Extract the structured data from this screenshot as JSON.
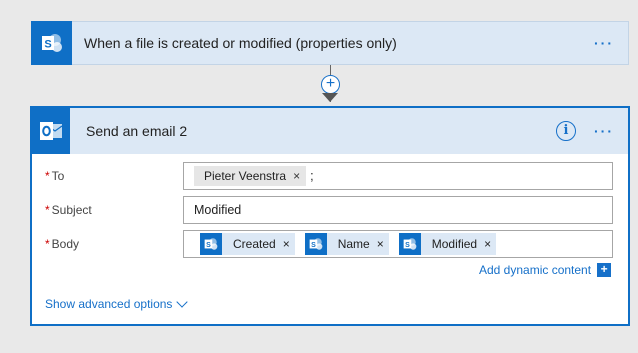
{
  "trigger": {
    "title": "When a file is created or modified (properties only)",
    "icon": "sharepoint-icon",
    "menu": "···"
  },
  "connector": {
    "add_symbol": "+"
  },
  "action": {
    "title": "Send an email 2",
    "icon": "outlook-icon",
    "info": "i",
    "menu": "···",
    "fields": {
      "to": {
        "label": "To",
        "required": "*",
        "chip": "Pieter Veenstra",
        "remove": "×",
        "separator": ";"
      },
      "subject": {
        "label": "Subject",
        "required": "*",
        "value": "Modified"
      },
      "body": {
        "label": "Body",
        "required": "*",
        "tokens": [
          {
            "label": "Created",
            "remove": "×"
          },
          {
            "label": "Name",
            "remove": "×"
          },
          {
            "label": "Modified",
            "remove": "×"
          }
        ]
      }
    },
    "add_dynamic_content": "Add dynamic content",
    "add_dynamic_plus": "+",
    "show_advanced": "Show advanced options"
  },
  "colors": {
    "brand_blue": "#0f6fc6",
    "link_blue": "#1670c9",
    "header_bg": "#dce8f5",
    "canvas_bg": "#e9e9e9",
    "required_red": "#cc0000"
  }
}
